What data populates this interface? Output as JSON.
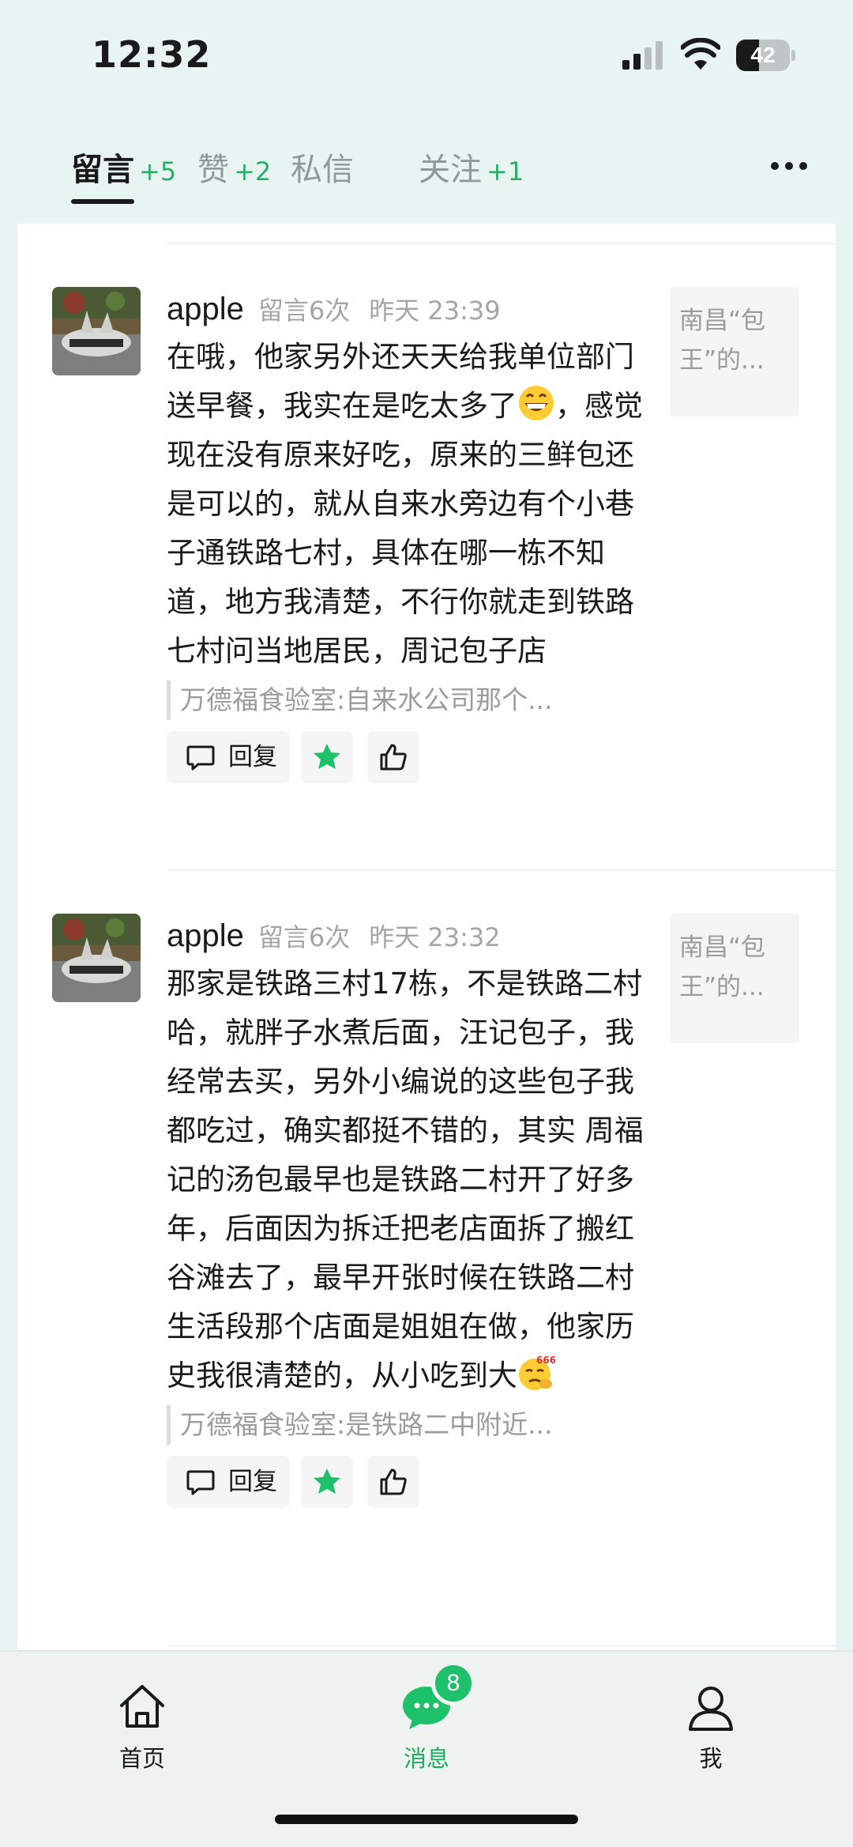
{
  "status_bar": {
    "time": "12:32",
    "battery": "42",
    "battery_level": 0.42,
    "icons": [
      "signal-icon",
      "wifi-icon",
      "battery-icon"
    ]
  },
  "tabs": [
    {
      "label": "留言",
      "count": "+5",
      "active": true
    },
    {
      "label": "赞",
      "count": "+2",
      "active": false
    },
    {
      "label": "私信",
      "count": "",
      "active": false
    },
    {
      "label": "关注",
      "count": "+1",
      "active": false
    }
  ],
  "comments": [
    {
      "username": "apple",
      "msg_count": "留言6次",
      "time": "昨天 23:39",
      "text_before_emoji": "在哦，他家另外还天天给我单位部门送早餐，我实在是吃太多了",
      "emoji": "grinning-face-emoji",
      "text_after_emoji": "，感觉现在没有原来好吃，原来的三鲜包还是可以的，就从自来水旁边有个小巷子通铁路七村，具体在哪一栋不知道，地方我清楚，不行你就走到铁路七村问当地居民，周记包子店",
      "quote": "万德福食验室:自来水公司那个...",
      "article": "南昌“包王”的...",
      "reply_label": "回复"
    },
    {
      "username": "apple",
      "msg_count": "留言6次",
      "time": "昨天 23:32",
      "text_before_emoji": "那家是铁路三村17栋，不是铁路二村哈，就胖子水煮后面，汪记包子，我经常去买，另外小编说的这些包子我都吃过，确实都挺不错的，其实 周福记的汤包最早也是铁路二村开了好多年，后面因为拆迁把老店面拆了搬红谷滩去了，最早开张时候在铁路二村生活段那个店面是姐姐在做，他家历史我很清楚的，从小吃到大",
      "emoji": "666-thinking-emoji",
      "text_after_emoji": "",
      "quote": "万德福食验室:是铁路二中附近...",
      "article": "南昌“包王”的...",
      "reply_label": "回复"
    }
  ],
  "bottom_nav": [
    {
      "label": "首页",
      "icon": "home-icon",
      "active": false
    },
    {
      "label": "消息",
      "icon": "message-icon",
      "active": true,
      "badge": "8"
    },
    {
      "label": "我",
      "icon": "profile-icon",
      "active": false
    }
  ],
  "colors": {
    "accent_green": "#1cc16a",
    "page_background": "#e8f4f2",
    "muted_text": "#a5a5a5"
  }
}
